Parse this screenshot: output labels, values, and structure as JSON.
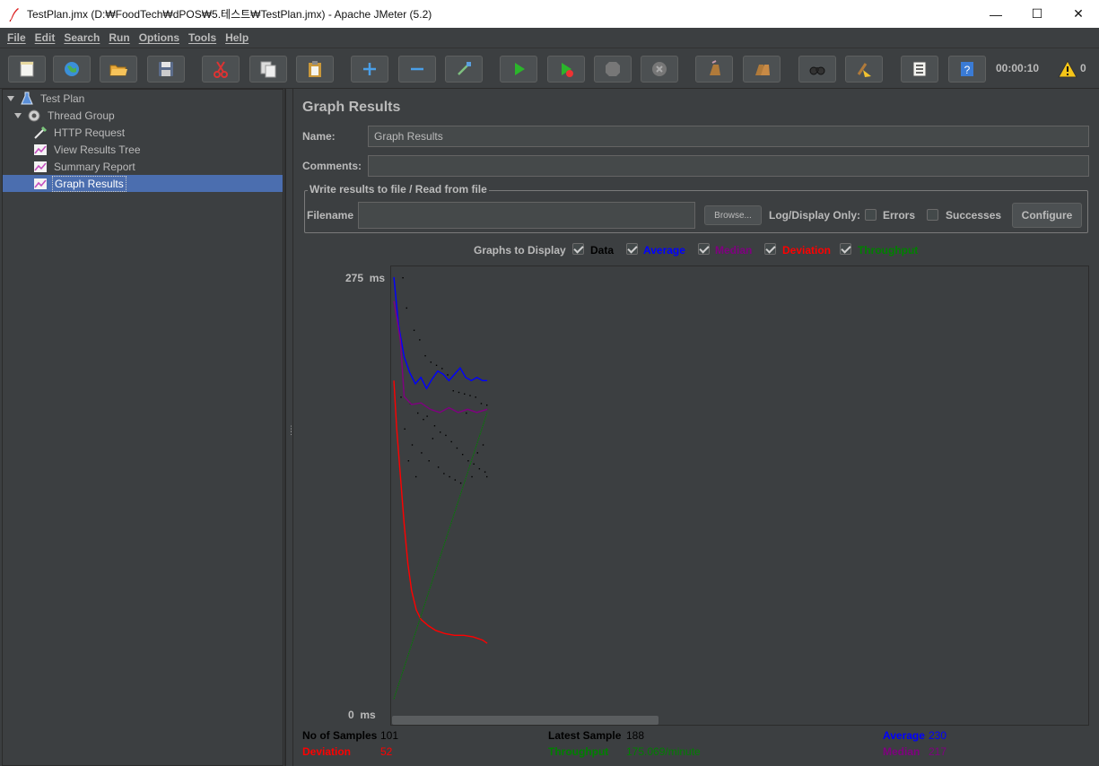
{
  "window": {
    "title": "TestPlan.jmx (D:₩FoodTech₩dPOS₩5.테스트₩TestPlan.jmx) - Apache JMeter (5.2)",
    "minimize": "—",
    "maximize": "☐",
    "close": "✕"
  },
  "menu": [
    "File",
    "Edit",
    "Search",
    "Run",
    "Options",
    "Tools",
    "Help"
  ],
  "toolbar": {
    "timer": "00:00:10",
    "warning_count": "0",
    "buttons": [
      "new-icon",
      "templates-icon",
      "open-icon",
      "save-icon",
      "cut-icon",
      "copy-icon",
      "paste-icon",
      "expand-icon",
      "collapse-icon",
      "toggle-icon",
      "start-icon",
      "start-no-pauses-icon",
      "stop-icon",
      "shutdown-icon",
      "clear-icon",
      "clear-all-icon",
      "search-icon",
      "reset-search-icon",
      "function-helper-icon",
      "help-icon"
    ]
  },
  "tree": [
    {
      "label": "Test Plan",
      "icon": "test-plan-icon",
      "level": 0,
      "expanded": true,
      "selected": false
    },
    {
      "label": "Thread Group",
      "icon": "thread-group-icon",
      "level": 1,
      "expanded": true,
      "selected": false
    },
    {
      "label": "HTTP Request",
      "icon": "http-sampler-icon",
      "level": 2,
      "selected": false
    },
    {
      "label": "View Results Tree",
      "icon": "listener-icon",
      "level": 2,
      "selected": false
    },
    {
      "label": "Summary Report",
      "icon": "listener-icon",
      "level": 2,
      "selected": false
    },
    {
      "label": "Graph Results",
      "icon": "listener-icon",
      "level": 2,
      "selected": true
    }
  ],
  "panel": {
    "title": "Graph Results",
    "name_label": "Name:",
    "name_value": "Graph Results",
    "comments_label": "Comments:",
    "comments_value": "",
    "file_group_title": "Write results to file / Read from file",
    "filename_label": "Filename",
    "filename_value": "",
    "browse_label": "Browse...",
    "log_display_label": "Log/Display Only:",
    "errors_label": "Errors",
    "successes_label": "Successes",
    "configure_label": "Configure",
    "graphs_to_display_label": "Graphs to Display"
  },
  "graph_options": [
    {
      "label": "Data",
      "checked": true,
      "color": "#000000"
    },
    {
      "label": "Average",
      "checked": true,
      "color": "#0000ff"
    },
    {
      "label": "Median",
      "checked": true,
      "color": "#800080"
    },
    {
      "label": "Deviation",
      "checked": true,
      "color": "#ff0000"
    },
    {
      "label": "Throughput",
      "checked": true,
      "color": "#008000"
    }
  ],
  "chart_data": {
    "type": "line",
    "y_max_label": "275",
    "y_min_label": "0",
    "y_unit": "ms",
    "ylim": [
      0,
      275
    ],
    "x_label": "",
    "sample_count": 101,
    "series": [
      {
        "name": "Average",
        "color": "#0000ff",
        "points": [
          [
            1,
            275
          ],
          [
            6,
            245
          ],
          [
            12,
            225
          ],
          [
            18,
            215
          ],
          [
            24,
            208
          ],
          [
            30,
            212
          ],
          [
            36,
            205
          ],
          [
            42,
            211
          ],
          [
            48,
            216
          ],
          [
            54,
            214
          ],
          [
            60,
            210
          ],
          [
            66,
            214
          ],
          [
            72,
            218
          ],
          [
            78,
            212
          ],
          [
            84,
            210
          ],
          [
            90,
            212
          ],
          [
            96,
            210
          ],
          [
            101,
            210
          ]
        ]
      },
      {
        "name": "Median",
        "color": "#800080",
        "points": [
          [
            1,
            260
          ],
          [
            4,
            250
          ],
          [
            8,
            235
          ],
          [
            12,
            200
          ],
          [
            20,
            195
          ],
          [
            30,
            196
          ],
          [
            40,
            192
          ],
          [
            50,
            190
          ],
          [
            60,
            193
          ],
          [
            70,
            190
          ],
          [
            80,
            192
          ],
          [
            90,
            190
          ],
          [
            101,
            192
          ]
        ]
      },
      {
        "name": "Deviation",
        "color": "#ff0000",
        "points": [
          [
            1,
            210
          ],
          [
            4,
            180
          ],
          [
            8,
            150
          ],
          [
            12,
            120
          ],
          [
            16,
            95
          ],
          [
            20,
            78
          ],
          [
            25,
            66
          ],
          [
            30,
            60
          ],
          [
            38,
            56
          ],
          [
            46,
            53
          ],
          [
            56,
            51
          ],
          [
            66,
            50
          ],
          [
            76,
            50
          ],
          [
            86,
            49
          ],
          [
            96,
            47
          ],
          [
            101,
            45
          ]
        ]
      },
      {
        "name": "Throughput",
        "color": "#008000",
        "points": [
          [
            1,
            10
          ],
          [
            101,
            190
          ]
        ]
      }
    ],
    "data_points": [
      [
        10,
        275
      ],
      [
        14,
        256
      ],
      [
        22,
        242
      ],
      [
        28,
        236
      ],
      [
        34,
        226
      ],
      [
        40,
        222
      ],
      [
        46,
        220
      ],
      [
        52,
        218
      ],
      [
        58,
        214
      ],
      [
        64,
        204
      ],
      [
        70,
        203
      ],
      [
        76,
        202
      ],
      [
        82,
        201
      ],
      [
        88,
        200
      ],
      [
        94,
        196
      ],
      [
        100,
        195
      ],
      [
        8,
        200
      ],
      [
        18,
        196
      ],
      [
        26,
        190
      ],
      [
        36,
        188
      ],
      [
        44,
        182
      ],
      [
        50,
        178
      ],
      [
        56,
        176
      ],
      [
        62,
        172
      ],
      [
        68,
        168
      ],
      [
        74,
        164
      ],
      [
        80,
        160
      ],
      [
        86,
        158
      ],
      [
        92,
        155
      ],
      [
        98,
        153
      ],
      [
        12,
        180
      ],
      [
        20,
        170
      ],
      [
        30,
        165
      ],
      [
        38,
        160
      ],
      [
        48,
        156
      ],
      [
        54,
        152
      ],
      [
        60,
        150
      ],
      [
        66,
        148
      ],
      [
        72,
        146
      ],
      [
        84,
        150
      ],
      [
        90,
        165
      ],
      [
        96,
        170
      ],
      [
        16,
        160
      ],
      [
        24,
        150
      ],
      [
        32,
        186
      ],
      [
        42,
        174
      ],
      [
        78,
        190
      ],
      [
        100,
        150
      ]
    ]
  },
  "stats": {
    "samples_label": "No of Samples",
    "samples_value": "101",
    "latest_label": "Latest Sample",
    "latest_value": "188",
    "average_label": "Average",
    "average_value": "230",
    "deviation_label": "Deviation",
    "deviation_value": "52",
    "throughput_label": "Throughput",
    "throughput_value": "175.069/minute",
    "median_label": "Median",
    "median_value": "217"
  },
  "colors": {
    "selection": "#4b6eaf",
    "background": "#3c3f41",
    "average": "#0000ff",
    "median": "#800080",
    "deviation": "#ff0000",
    "throughput": "#008000",
    "data": "#000000"
  }
}
